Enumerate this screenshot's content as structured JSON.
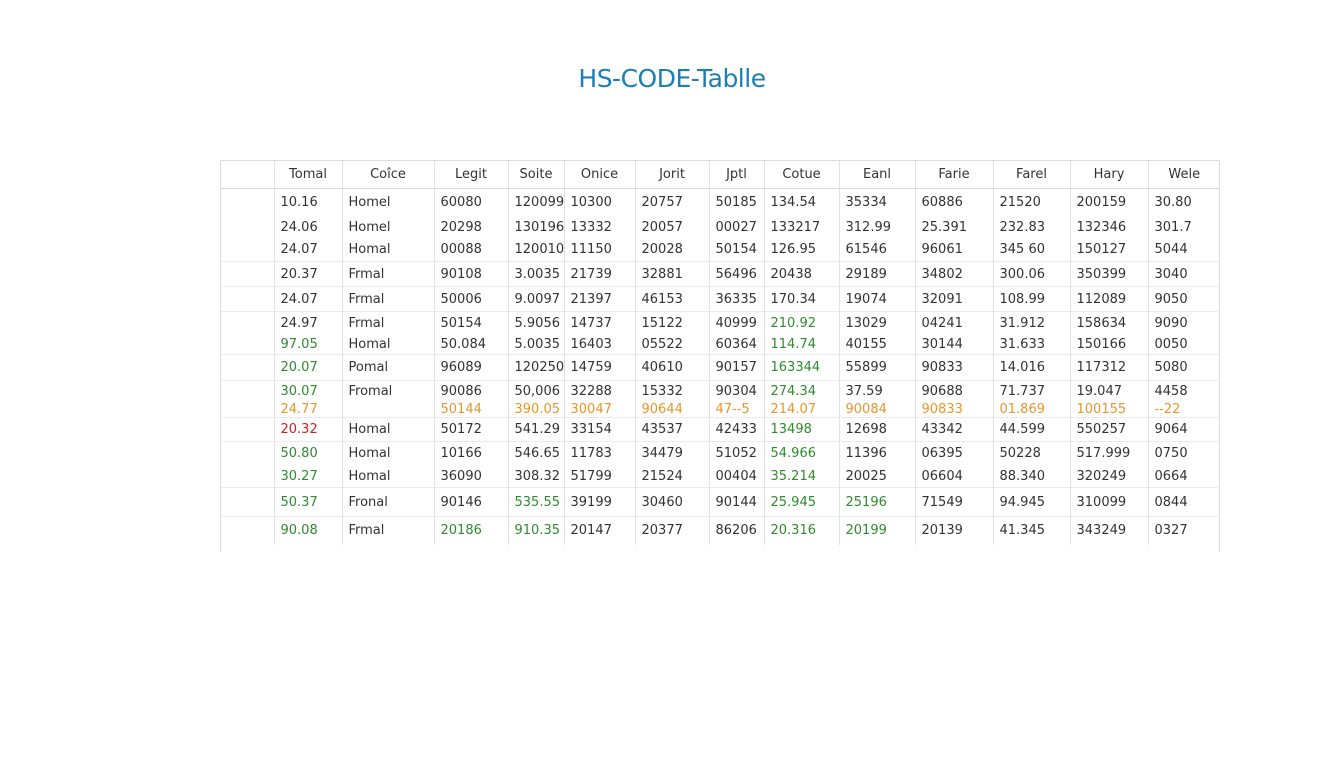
{
  "title": "HS-CODE-Tablle",
  "colors": {
    "title": "#1a7fb5",
    "text": "#333333",
    "green": "#2e8b2e",
    "red": "#cc2222",
    "orange": "#e8962a",
    "grid": "#e2e2e2"
  },
  "columns": [
    "",
    "Tomal",
    "Coîce",
    "Legit",
    "Soite",
    "Onice",
    "Jorit",
    "Jptl",
    "Cotue",
    "Eanl",
    "Farie",
    "Farel",
    "Hary",
    "Wele"
  ],
  "rows": [
    {
      "cells": [
        "",
        "10.16",
        "Homel",
        "60080",
        "120099",
        "10300",
        "20757",
        "50185",
        "134.54",
        "35334",
        "60886",
        "21520",
        "200159",
        "30.80"
      ],
      "green": []
    },
    {
      "cells": [
        "",
        "24.06",
        "Homel",
        "20298",
        "130196",
        "13332",
        "20057",
        "00027",
        "133217",
        "312.99",
        "25.391",
        "232.83",
        "132346",
        "301.7"
      ],
      "green": []
    },
    {
      "cells": [
        "",
        "24.07",
        "Homal",
        "00088",
        "120010",
        "11150",
        "20028",
        "50154",
        "126.95",
        "61546",
        "96061",
        "345 60",
        "150127",
        "5044"
      ],
      "green": []
    },
    {
      "cells": [
        "",
        "20.37",
        "Frmal",
        "90108",
        "3.0035",
        "21739",
        "32881",
        "56496",
        "20438",
        "29189",
        "34802",
        "300.06",
        "350399",
        "3040"
      ],
      "green": []
    },
    {
      "cells": [
        "",
        "24.07",
        "Frmal",
        "50006",
        "9.0097",
        "21397",
        "46153",
        "36335",
        "170.34",
        "19074",
        "32091",
        "108.99",
        "112089",
        "9050"
      ],
      "green": []
    },
    {
      "cells": [
        "",
        "24.97",
        "Frmal",
        "50154",
        "5.9056",
        "14737",
        "15122",
        "40999",
        "210.92",
        "13029",
        "04241",
        "31.912",
        "158634",
        "9090"
      ],
      "green": [
        8
      ]
    },
    {
      "cells": [
        "",
        "97.05",
        "Homal",
        "50.084",
        "5.0035",
        "16403",
        "05522",
        "60364",
        "114.74",
        "40155",
        "30144",
        "31.633",
        "150166",
        "0050"
      ],
      "green": [
        1,
        8
      ]
    },
    {
      "cells": [
        "",
        "20.07",
        "Pomal",
        "96089",
        "120250",
        "14759",
        "40610",
        "90157",
        "163344",
        "55899",
        "90833",
        "14.016",
        "117312",
        "5080"
      ],
      "green": [
        1,
        8
      ]
    },
    {
      "cells": [
        "",
        "30.07",
        "Fromal",
        "90086",
        "50,006",
        "32288",
        "15332",
        "90304",
        "274.34",
        "37.59",
        "90688",
        "71.737",
        "19.047",
        "4458"
      ],
      "green": [
        1,
        8
      ]
    },
    {
      "cells": [
        "",
        "24.77",
        "",
        "50144",
        "390.05",
        "30047",
        "90644",
        "47--5",
        "214.07",
        "90084",
        "90833",
        "01.869",
        "100155",
        "--22"
      ],
      "orange": true
    },
    {
      "cells": [
        "",
        "20.32",
        "Homal",
        "50172",
        "541.29",
        "33154",
        "43537",
        "42433",
        "13498",
        "12698",
        "43342",
        "44.599",
        "550257",
        "9064"
      ],
      "green": [
        8
      ],
      "red": [
        1
      ]
    },
    {
      "cells": [
        "",
        "50.80",
        "Homal",
        "10166",
        "546.65",
        "11783",
        "34479",
        "51052",
        "54.966",
        "11396",
        "06395",
        "50228",
        "517.999",
        "0750"
      ],
      "green": [
        1,
        8
      ]
    },
    {
      "cells": [
        "",
        "30.27",
        "Homal",
        "36090",
        "308.32",
        "51799",
        "21524",
        "00404",
        "35.214",
        "20025",
        "06604",
        "88.340",
        "320249",
        "0664"
      ],
      "green": [
        1,
        8
      ]
    },
    {
      "cells": [
        "",
        "50.37",
        "Fronal",
        "90146",
        "535.55",
        "39199",
        "30460",
        "90144",
        "25.945",
        "25196",
        "71549",
        "94.945",
        "310099",
        "0844"
      ],
      "green": [
        1,
        4,
        8,
        9
      ]
    },
    {
      "cells": [
        "",
        "90.08",
        "Frmal",
        "20186",
        "910.35",
        "20147",
        "20377",
        "86206",
        "20.316",
        "20199",
        "20139",
        "41.345",
        "343249",
        "0327"
      ],
      "green": [
        1,
        3,
        4,
        8,
        9
      ]
    }
  ]
}
